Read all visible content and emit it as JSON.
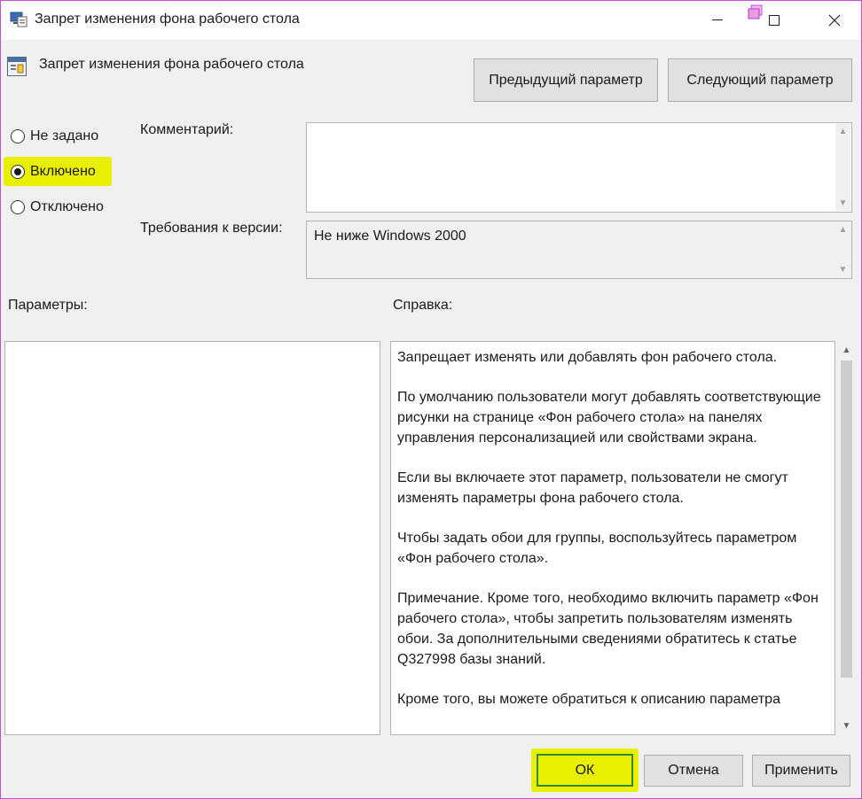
{
  "window": {
    "title": "Запрет изменения фона рабочего стола",
    "minimize_icon": "minimize-icon",
    "maximize_icon": "maximize-icon",
    "close_icon": "close-icon"
  },
  "header": {
    "policy_title": "Запрет изменения фона рабочего стола",
    "prev_button": "Предыдущий параметр",
    "next_button": "Следующий параметр"
  },
  "state": {
    "options": [
      "Не задано",
      "Включено",
      "Отключено"
    ],
    "selected": "Включено"
  },
  "comment": {
    "label": "Комментарий:",
    "value": ""
  },
  "requirements": {
    "label": "Требования к версии:",
    "value": "Не ниже Windows 2000"
  },
  "panels": {
    "options_label": "Параметры:",
    "help_label": "Справка:"
  },
  "help": {
    "paragraphs": [
      "Запрещает изменять или добавлять фон рабочего стола.",
      "По умолчанию пользователи могут добавлять соответствующие рисунки на странице «Фон рабочего стола» на панелях управления персонализацией или свойствами экрана.",
      "Если вы включаете этот параметр, пользователи не смогут изменять параметры фона рабочего стола.",
      "Чтобы задать обои для группы, воспользуйтесь параметром «Фон рабочего стола».",
      "Примечание. Кроме того, необходимо включить параметр «Фон рабочего стола», чтобы запретить пользователям изменять обои. За дополнительными сведениями обратитесь к статье Q327998 базы знаний.",
      "Кроме того, вы можете обратиться к описанию параметра"
    ]
  },
  "footer": {
    "ok": "ОК",
    "cancel": "Отмена",
    "apply": "Применить"
  },
  "colors": {
    "highlight": "#e8f000",
    "ok_border": "#2e8b2e",
    "frame": "#c24fd6"
  }
}
